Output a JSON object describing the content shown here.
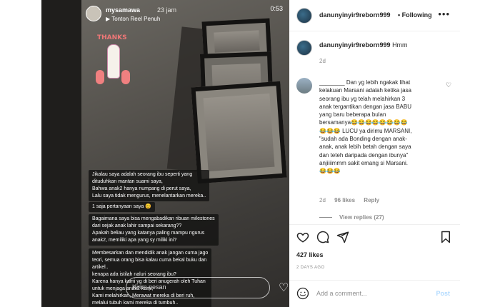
{
  "story": {
    "username": "mysamawa",
    "time_ago": "23 jam",
    "reel_label": "Tonton Reel Penuh",
    "clock": "0:53",
    "sticker_text": "THANKS",
    "caption_lines": [
      "Jikalau saya adalah seorang ibu seperti yang",
      "dituduhkan mantan suami saya,",
      "Bahwa anak2 hanya numpang di perut saya,",
      "Lalu saya tidak mengurus, menelantarkan mereka..",
      "1 saja pertanyaan saya 😊",
      "Bagaimana saya bisa mengabadikan ribuan milestones",
      "dari sejak anak lahir sampai sekarang??",
      "Apakah beliau yang katanya paling mampu ngurus",
      "anak2, memiliki apa yang sy miliki ini?",
      "Membesarkan dan mendidik anak jangan cuma jago",
      "teori, semua orang bisa kalau cuma bekal buku dan",
      "artikel..",
      "kenapa ada istilah naluri seorang ibu?",
      "Karena hanya kami yg di beri anugerah oleh Tuhan",
      "untuk menjaga anak2 kami,",
      "Kami melahirkan, Merawat mereka di beri ruh,",
      "melalui tubuh kami mereka di tumbuh.."
    ],
    "reply_placeholder": "Kirim pesan"
  },
  "post": {
    "username": "danunyinyir9reborn999",
    "follow_label": "Following",
    "caption_user": "danunyinyir9reborn999",
    "caption_text": "Hmm",
    "caption_time": "2d",
    "comment_lines": [
      "________ Dan yg lebih ngakak lihat",
      "kelakuan Marsani adalah ketika jasa",
      "seorang ibu yg telah melahirkan 3",
      "anak tergantikan dengan jasa BABU",
      "yang baru beberapa bulan",
      "bersamanya😂😂😂😂😂😂😂😂",
      "😂😂😂 LUCU ya dirimu MARSANI,",
      "\"sudah ada Bonding dengan anak-",
      "anak, anak lebih betah dengan saya",
      "dan teteh daripada dengan ibunya\"",
      "anjiiiimmm sakit emang si Marsani.",
      "😂😂😂"
    ],
    "comment_time": "2d",
    "comment_likes": "96 likes",
    "reply_label": "Reply",
    "view_replies": "View replies (27)",
    "likes": "427 likes",
    "date": "2 DAYS AGO",
    "add_comment_placeholder": "Add a comment...",
    "post_label": "Post"
  },
  "colors": {
    "text_primary": "#262626",
    "text_secondary": "#8e8e8e",
    "post_button_disabled": "#b3dbff",
    "caption_bg": "#141312"
  }
}
